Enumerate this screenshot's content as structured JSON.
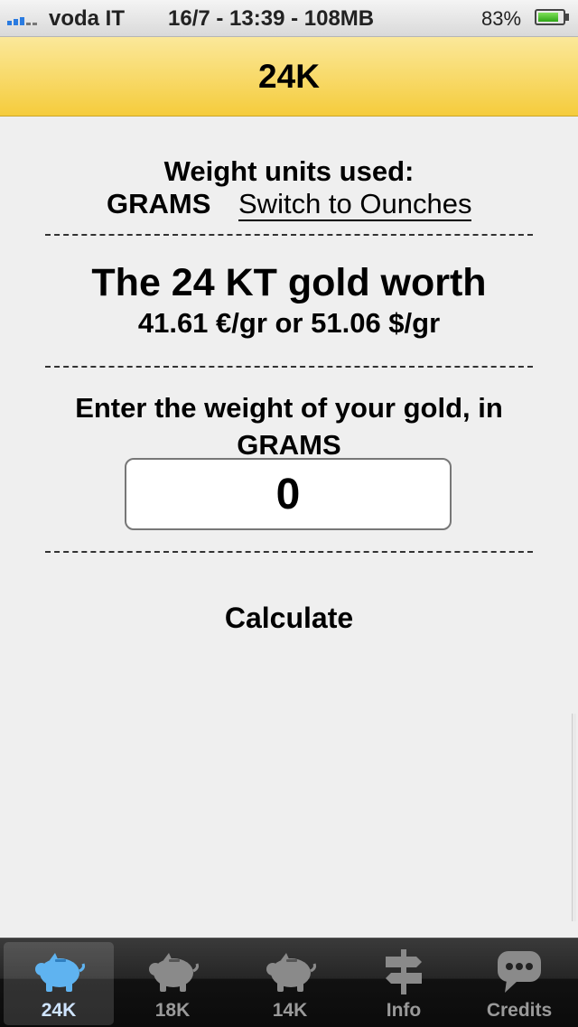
{
  "status_bar": {
    "carrier": "voda IT",
    "center_text": "16/7 - 13:39 - 108MB",
    "battery_percent": "83%",
    "battery_level": 0.83
  },
  "nav": {
    "title": "24K"
  },
  "units": {
    "label": "Weight units used:",
    "current": "GRAMS",
    "switch_link": "Switch to Ounches"
  },
  "price": {
    "title": "The 24 KT gold worth",
    "value_text": "41.61 €/gr or 51.06 $/gr"
  },
  "weight": {
    "prompt": "Enter the weight of your gold, in GRAMS",
    "value": "0"
  },
  "calculate_label": "Calculate",
  "tabs": [
    {
      "label": "24K",
      "icon": "piggy-bank-icon",
      "active": true
    },
    {
      "label": "18K",
      "icon": "piggy-bank-icon",
      "active": false
    },
    {
      "label": "14K",
      "icon": "piggy-bank-icon",
      "active": false
    },
    {
      "label": "Info",
      "icon": "signpost-icon",
      "active": false
    },
    {
      "label": "Credits",
      "icon": "speech-bubble-icon",
      "active": false
    }
  ],
  "colors": {
    "nav_yellow": "#f5cc3c",
    "active_icon_blue": "#5fb3f0",
    "inactive_icon_gray": "#8a8a8a"
  }
}
